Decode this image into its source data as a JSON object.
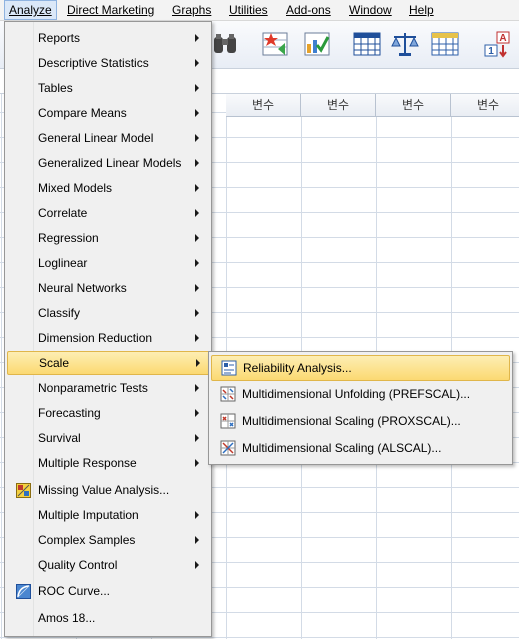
{
  "menubar": {
    "items": [
      {
        "label": "Analyze"
      },
      {
        "label": "Direct Marketing"
      },
      {
        "label": "Graphs"
      },
      {
        "label": "Utilities"
      },
      {
        "label": "Add-ons"
      },
      {
        "label": "Window"
      },
      {
        "label": "Help"
      }
    ]
  },
  "toolbar": {
    "icons": [
      "binoculars-icon",
      "star-chart-icon",
      "chart-check-icon",
      "table-grid-icon",
      "scale-balance-icon",
      "table-grid-icon",
      "value-labels-icon"
    ]
  },
  "grid": {
    "column_headers": [
      "변수",
      "변수",
      "변수",
      "변수"
    ]
  },
  "analyze_menu": {
    "items": [
      {
        "label": "Reports"
      },
      {
        "label": "Descriptive Statistics"
      },
      {
        "label": "Tables"
      },
      {
        "label": "Compare Means"
      },
      {
        "label": "General Linear Model"
      },
      {
        "label": "Generalized Linear Models"
      },
      {
        "label": "Mixed Models"
      },
      {
        "label": "Correlate"
      },
      {
        "label": "Regression"
      },
      {
        "label": "Loglinear"
      },
      {
        "label": "Neural Networks"
      },
      {
        "label": "Classify"
      },
      {
        "label": "Dimension Reduction"
      },
      {
        "label": "Scale"
      },
      {
        "label": "Nonparametric Tests"
      },
      {
        "label": "Forecasting"
      },
      {
        "label": "Survival"
      },
      {
        "label": "Multiple Response"
      },
      {
        "label": "Missing Value Analysis..."
      },
      {
        "label": "Multiple Imputation"
      },
      {
        "label": "Complex Samples"
      },
      {
        "label": "Quality Control"
      },
      {
        "label": "ROC Curve..."
      },
      {
        "label": "Amos 18..."
      }
    ],
    "highlighted": "Scale"
  },
  "scale_submenu": {
    "items": [
      {
        "label": "Reliability Analysis..."
      },
      {
        "label": "Multidimensional Unfolding (PREFSCAL)..."
      },
      {
        "label": "Multidimensional Scaling (PROXSCAL)..."
      },
      {
        "label": "Multidimensional Scaling (ALSCAL)..."
      }
    ],
    "highlighted": "Reliability Analysis..."
  }
}
